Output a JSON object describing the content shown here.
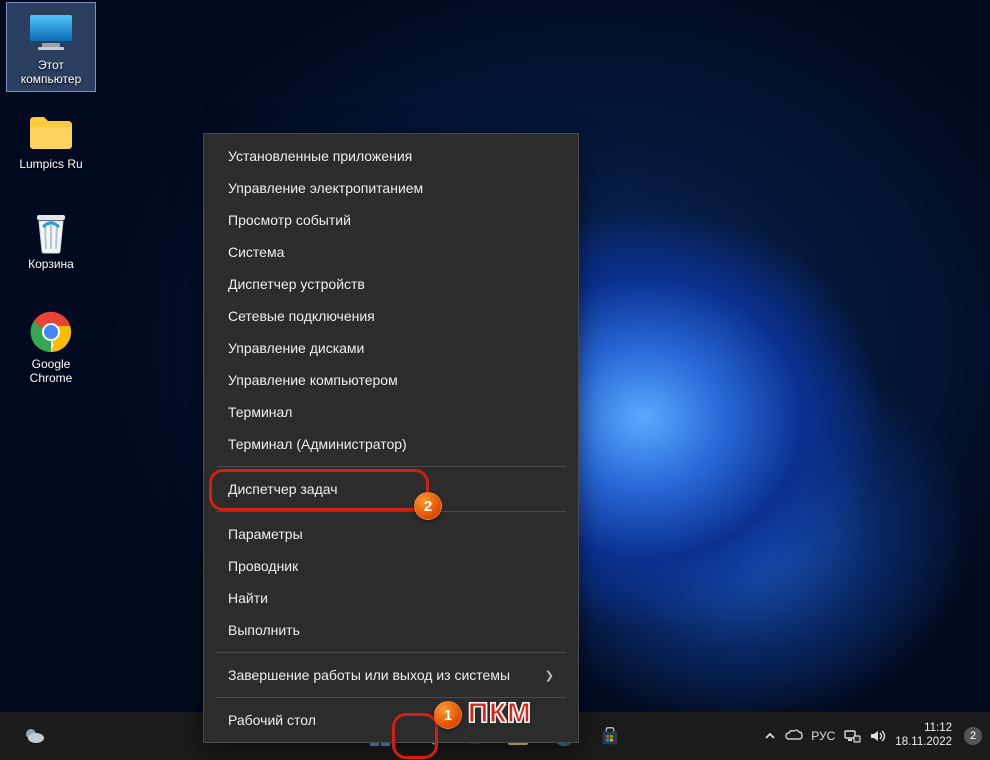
{
  "desktop_icons": [
    {
      "name": "this-pc",
      "label": "Этот\nкомпьютер",
      "selected": true
    },
    {
      "name": "folder-lumpics",
      "label": "Lumpics Ru"
    },
    {
      "name": "recycle-bin",
      "label": "Корзина"
    },
    {
      "name": "chrome",
      "label": "Google\nChrome"
    }
  ],
  "context_menu": [
    {
      "label": "Установленные приложения"
    },
    {
      "label": "Управление электропитанием"
    },
    {
      "label": "Просмотр событий"
    },
    {
      "label": "Система"
    },
    {
      "label": "Диспетчер устройств"
    },
    {
      "label": "Сетевые подключения"
    },
    {
      "label": "Управление дисками"
    },
    {
      "label": "Управление компьютером"
    },
    {
      "label": "Терминал"
    },
    {
      "label": "Терминал (Администратор)"
    },
    {
      "sep": true
    },
    {
      "label": "Диспетчер задач",
      "highlight": true
    },
    {
      "sep": true
    },
    {
      "label": "Параметры"
    },
    {
      "label": "Проводник"
    },
    {
      "label": "Найти"
    },
    {
      "label": "Выполнить"
    },
    {
      "sep": true
    },
    {
      "label": "Завершение работы или выход из системы",
      "submenu": true
    },
    {
      "sep": true
    },
    {
      "label": "Рабочий стол"
    }
  ],
  "annotations": {
    "badge1": "1",
    "badge2": "2",
    "rmb_label": "ПКМ"
  },
  "tray": {
    "lang": "РУС",
    "time": "11:12",
    "date": "18.11.2022",
    "notif_count": "2"
  }
}
